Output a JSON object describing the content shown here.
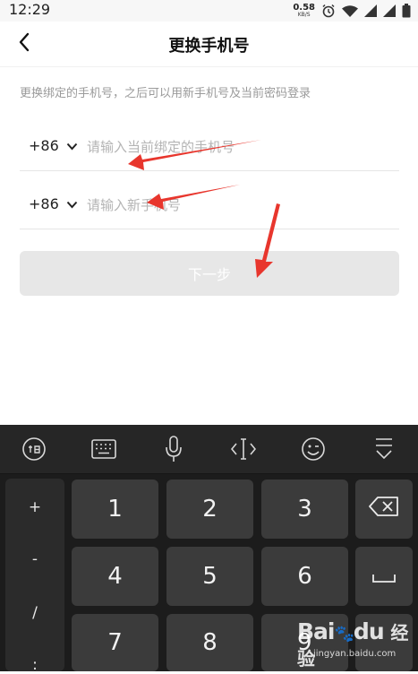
{
  "status_bar": {
    "time": "12:29",
    "net_speed_value": "0.58",
    "net_speed_unit": "KB/S",
    "icons": [
      "alarm-icon",
      "wifi-icon",
      "signal-icon",
      "signal-icon",
      "battery-icon"
    ]
  },
  "nav": {
    "back_icon": "chevron-left-icon",
    "title": "更换手机号"
  },
  "hint": "更换绑定的手机号，之后可以用新手机号及当前密码登录",
  "current_phone": {
    "country_code": "+86",
    "value": "",
    "placeholder": "请输入当前绑定的手机号"
  },
  "new_phone": {
    "country_code": "+86",
    "value": "",
    "placeholder": "请输入新手机号"
  },
  "next_button": {
    "label": "下一步",
    "enabled": false
  },
  "annotation_arrow_color": "#e8362d",
  "keyboard": {
    "toolbar": [
      "ime-logo-icon",
      "keyboard-icon",
      "microphone-icon",
      "cursor-icon",
      "emoji-icon",
      "hide-keyboard-icon"
    ],
    "symbols": [
      "+",
      "-",
      "/",
      ":"
    ],
    "keys": [
      "1",
      "2",
      "3",
      "4",
      "5",
      "6",
      "7",
      "8",
      "9"
    ],
    "backspace_icon": "backspace-icon",
    "space_icon": "space-icon"
  },
  "watermark": {
    "logo_text": "Bai",
    "logo_suffix": "du",
    "jingyan_text": "经验",
    "url": "jingyan.baidu.com"
  }
}
